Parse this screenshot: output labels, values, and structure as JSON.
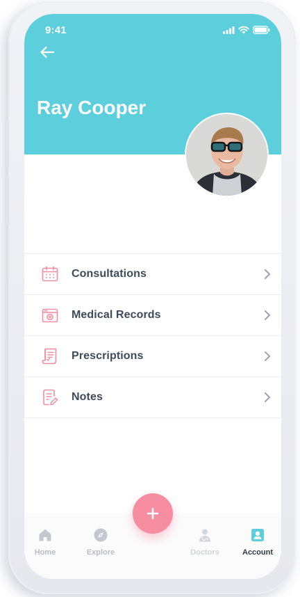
{
  "status_bar": {
    "time": "9:41",
    "signal_icon": "signal-icon",
    "wifi_icon": "wifi-icon",
    "battery_icon": "battery-icon"
  },
  "header": {
    "back_icon": "arrow-left-icon",
    "user_name": "Ray Cooper",
    "background_color": "#5dcfdc"
  },
  "menu": {
    "items": [
      {
        "label": "Consultations",
        "icon": "calendar-icon"
      },
      {
        "label": "Medical Records",
        "icon": "medical-folder-icon"
      },
      {
        "label": "Prescriptions",
        "icon": "prescription-scroll-icon"
      },
      {
        "label": "Notes",
        "icon": "note-edit-icon"
      }
    ],
    "icon_color": "#f08da0",
    "chevron_color": "#9aa3ae"
  },
  "fab": {
    "icon": "plus-icon",
    "color": "#f78da1"
  },
  "tabbar": {
    "tabs": [
      {
        "label": "Home",
        "icon": "home-icon",
        "active": false
      },
      {
        "label": "Explore",
        "icon": "compass-icon",
        "active": false
      },
      {
        "label": "Doctors",
        "icon": "doctor-icon",
        "active": false
      },
      {
        "label": "Account",
        "icon": "account-icon",
        "active": true
      }
    ],
    "active_color": "#5dcfdc"
  }
}
